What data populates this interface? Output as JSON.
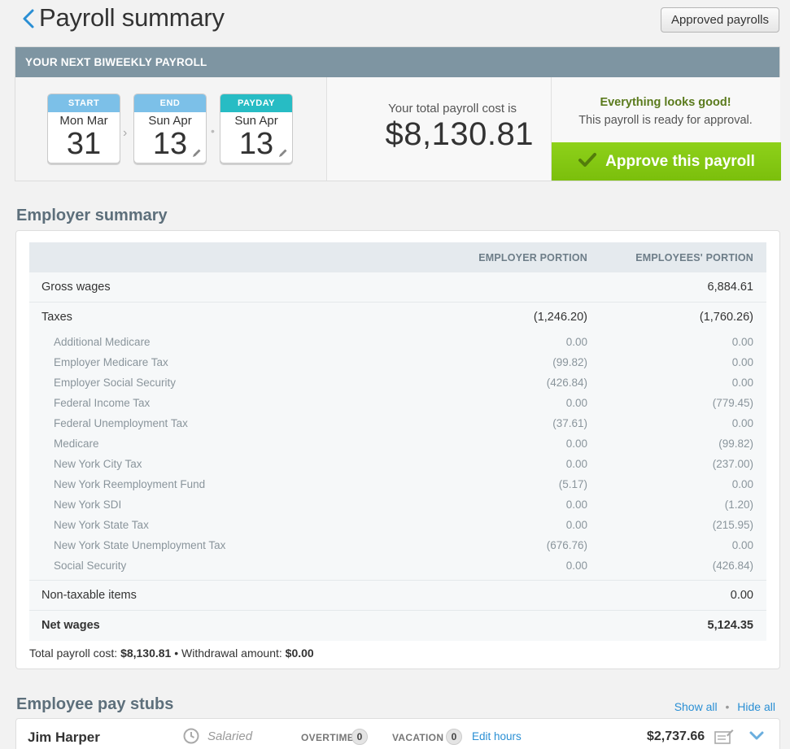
{
  "header": {
    "title": "Payroll summary",
    "approved_button": "Approved payrolls"
  },
  "payroll": {
    "banner": "YOUR NEXT BIWEEKLY PAYROLL",
    "start": {
      "label": "START",
      "dow": "Mon Mar",
      "day": "31"
    },
    "end": {
      "label": "END",
      "dow": "Sun Apr",
      "day": "13"
    },
    "payday": {
      "label": "PAYDAY",
      "dow": "Sun Apr",
      "day": "13"
    },
    "total_label": "Your total payroll cost is",
    "total_amount": "$8,130.81",
    "status_title": "Everything looks good!",
    "status_sub": "This payroll is ready for approval.",
    "approve_button": "Approve this payroll",
    "accent_color": "#7fc31c"
  },
  "employer_summary": {
    "title": "Employer summary",
    "columns": [
      "EMPLOYER PORTION",
      "EMPLOYEES' PORTION"
    ],
    "gross_wages": {
      "label": "Gross wages",
      "employer": "",
      "employees": "6,884.61"
    },
    "taxes": {
      "label": "Taxes",
      "employer": "(1,246.20)",
      "employees": "(1,760.26)"
    },
    "tax_lines": [
      {
        "label": "Additional Medicare",
        "employer": "0.00",
        "employees": "0.00"
      },
      {
        "label": "Employer Medicare Tax",
        "employer": "(99.82)",
        "employees": "0.00"
      },
      {
        "label": "Employer Social Security",
        "employer": "(426.84)",
        "employees": "0.00"
      },
      {
        "label": "Federal Income Tax",
        "employer": "0.00",
        "employees": "(779.45)"
      },
      {
        "label": "Federal Unemployment Tax",
        "employer": "(37.61)",
        "employees": "0.00"
      },
      {
        "label": "Medicare",
        "employer": "0.00",
        "employees": "(99.82)"
      },
      {
        "label": "New York City Tax",
        "employer": "0.00",
        "employees": "(237.00)"
      },
      {
        "label": "New York Reemployment Fund",
        "employer": "(5.17)",
        "employees": "0.00"
      },
      {
        "label": "New York SDI",
        "employer": "0.00",
        "employees": "(1.20)"
      },
      {
        "label": "New York State Tax",
        "employer": "0.00",
        "employees": "(215.95)"
      },
      {
        "label": "New York State Unemployment Tax",
        "employer": "(676.76)",
        "employees": "0.00"
      },
      {
        "label": "Social Security",
        "employer": "0.00",
        "employees": "(426.84)"
      }
    ],
    "non_taxable": {
      "label": "Non-taxable items",
      "employer": "",
      "employees": "0.00"
    },
    "net_wages": {
      "label": "Net wages",
      "employer": "",
      "employees": "5,124.35"
    },
    "footer": {
      "total_label": "Total payroll cost:",
      "total_value": "$8,130.81",
      "separator": "•",
      "withdrawal_label": "Withdrawal amount:",
      "withdrawal_value": "$0.00"
    }
  },
  "pay_stubs": {
    "title": "Employee pay stubs",
    "show_all": "Show all",
    "separator": "•",
    "hide_all": "Hide all",
    "employees": [
      {
        "name": "Jim Harper",
        "type": "Salaried",
        "overtime_label": "OVERTIME",
        "overtime": "0",
        "vacation_label": "VACATION",
        "vacation": "0",
        "edit_hours": "Edit hours",
        "amount": "$2,737.66",
        "icons": [
          "clock-icon",
          "paystub-icon",
          "chevron-down-icon"
        ]
      }
    ]
  }
}
